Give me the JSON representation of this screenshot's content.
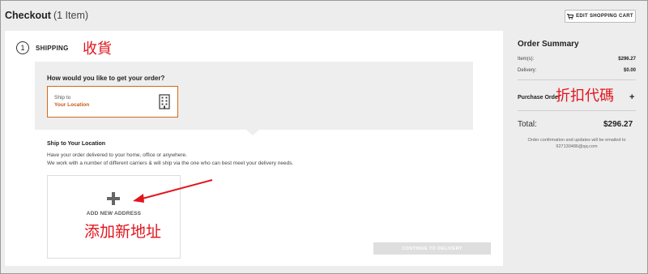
{
  "header": {
    "title": "Checkout",
    "item_count": "(1 Item)",
    "edit_cart_label": "EDIT SHOPPING CART"
  },
  "shipping": {
    "step_number": "1",
    "step_label": "SHIPPING",
    "annotation": "收貨",
    "question": "How would you like to get your order?",
    "option": {
      "line1": "Ship to",
      "line2": "Your Location",
      "icon": "building-icon"
    },
    "location_title": "Ship to Your Location",
    "location_desc1": "Have your order delivered to your home, office or anywhere.",
    "location_desc2": "We work with a number of different carriers & will ship via the one who can best meet your delivery needs.",
    "add_address_label": "ADD NEW ADDRESS",
    "add_address_annotation": "添加新地址",
    "continue_label": "CONTINUE TO DELIVERY"
  },
  "summary": {
    "title": "Order Summary",
    "items_label": "Item(s):",
    "items_value": "$296.27",
    "delivery_label": "Delivery:",
    "delivery_value": "$0.00",
    "promo_label": "Purchase Order",
    "promo_annotation": "折扣代碼",
    "total_label": "Total:",
    "total_value": "$296.27",
    "note_line1": "Order confirmation and updates will be emailed to",
    "note_line2": "927130486@qq.com"
  },
  "colors": {
    "accent_orange": "#d2691e",
    "annotation_red": "#e2141e"
  }
}
